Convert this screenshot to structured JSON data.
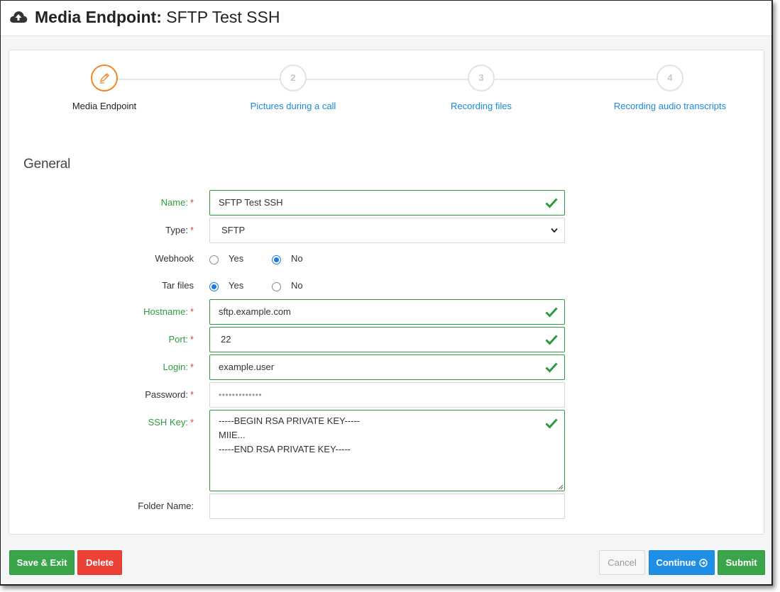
{
  "header": {
    "title_prefix": "Media Endpoint:",
    "title_name": "SFTP Test SSH",
    "icon": "cloud-upload-icon"
  },
  "steps": [
    {
      "number": "",
      "label": "Media Endpoint",
      "icon": "pencil-icon",
      "active": true
    },
    {
      "number": "2",
      "label": "Pictures during a call",
      "active": false
    },
    {
      "number": "3",
      "label": "Recording files",
      "active": false
    },
    {
      "number": "4",
      "label": "Recording audio transcripts",
      "active": false
    }
  ],
  "section_title": "General",
  "form": {
    "required_mark": "*",
    "name": {
      "label": "Name:",
      "value": "SFTP Test SSH",
      "valid": true
    },
    "type": {
      "label": "Type:",
      "value": "SFTP"
    },
    "webhook": {
      "label": "Webhook",
      "options": [
        "Yes",
        "No"
      ],
      "selected": "No"
    },
    "tar_files": {
      "label": "Tar files",
      "options": [
        "Yes",
        "No"
      ],
      "selected": "Yes"
    },
    "hostname": {
      "label": "Hostname:",
      "value": "sftp.example.com",
      "valid": true
    },
    "port": {
      "label": "Port:",
      "value": "22",
      "valid": true
    },
    "login": {
      "label": "Login:",
      "value": "example.user",
      "valid": true
    },
    "password": {
      "label": "Password:",
      "value": "•••••••••••••"
    },
    "ssh_key": {
      "label": "SSH Key:",
      "value": "-----BEGIN RSA PRIVATE KEY-----\nMIIE...\n-----END RSA PRIVATE KEY-----",
      "valid": true
    },
    "folder_name": {
      "label": "Folder Name:",
      "value": ""
    }
  },
  "buttons": {
    "save_exit": "Save & Exit",
    "delete": "Delete",
    "cancel": "Cancel",
    "continue": "Continue",
    "submit": "Submit"
  },
  "colors": {
    "valid": "#2e9a3e",
    "required": "#e0453a",
    "link": "#1a8ad6",
    "active_step": "#f0862a",
    "primary": "#1f8fe5",
    "success": "#3aa54a",
    "danger": "#eb4136"
  }
}
